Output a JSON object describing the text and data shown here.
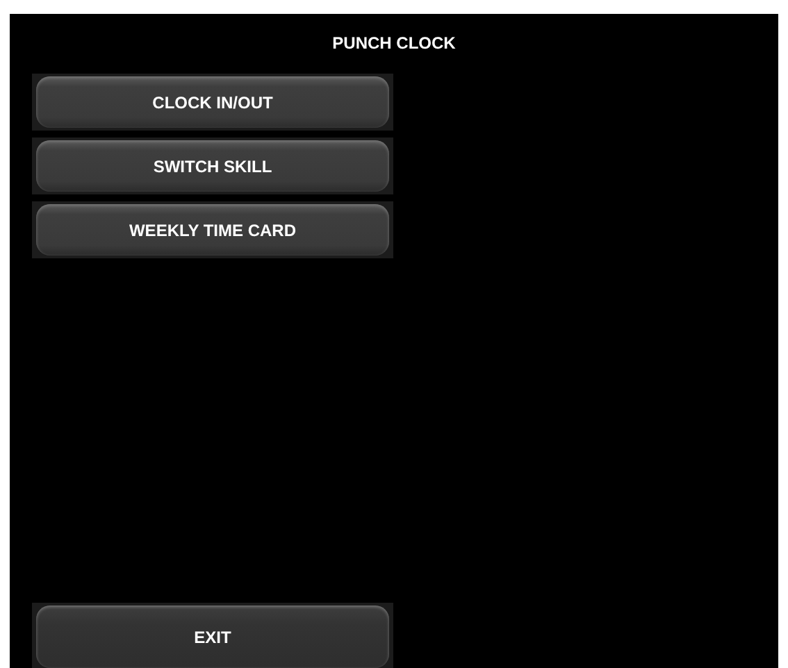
{
  "window": {
    "title": "PUNCH CLOCK"
  },
  "menu_buttons": [
    {
      "label": "CLOCK IN/OUT"
    },
    {
      "label": "SWITCH SKILL"
    },
    {
      "label": "WEEKLY TIME CARD"
    }
  ],
  "exit_button": {
    "label": "EXIT"
  }
}
